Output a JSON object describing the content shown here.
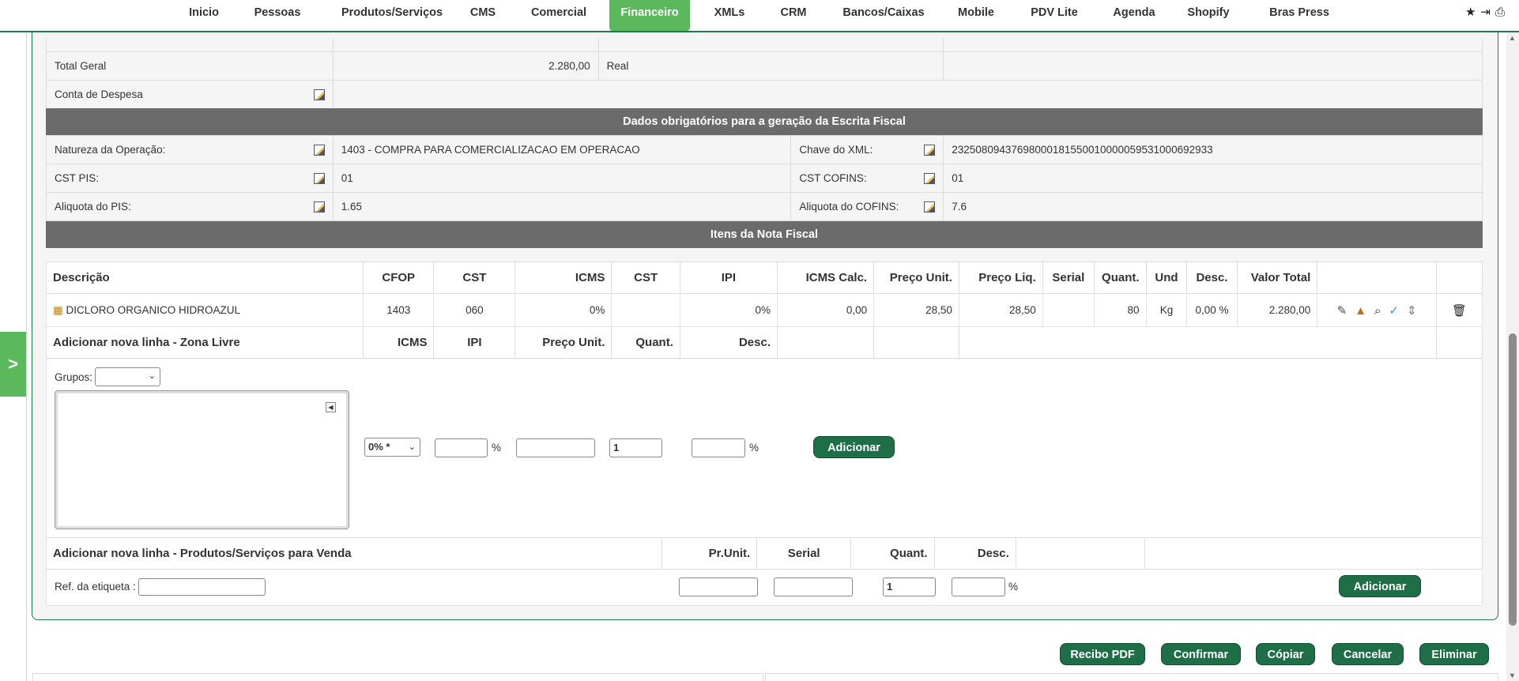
{
  "nav": {
    "items": [
      "Inicio",
      "Pessoas",
      "Produtos/Serviços",
      "CMS",
      "Comercial",
      "Financeiro",
      "XMLs",
      "CRM",
      "Bancos/Caixas",
      "Mobile",
      "PDV Lite",
      "Agenda",
      "Shopify",
      "Bras Press"
    ],
    "active": "Financeiro",
    "icons": [
      "star-icon",
      "logout-icon",
      "print-icon"
    ]
  },
  "summary": {
    "total_label": "Total Geral",
    "total_value": "2.280,00",
    "currency": "Real",
    "expense_label": "Conta de Despesa"
  },
  "fiscal": {
    "section_title": "Dados obrigatórios para a geração da Escrita Fiscal",
    "natureza_label": "Natureza da Operação:",
    "natureza_value": "1403 - COMPRA PARA COMERCIALIZACAO EM OPERACAO",
    "chave_label": "Chave do XML:",
    "chave_value": "23250809437698000181550010000059531000692933",
    "cst_pis_label": "CST PIS:",
    "cst_pis_value": "01",
    "cst_cofins_label": "CST COFINS:",
    "cst_cofins_value": "01",
    "aliq_pis_label": "Aliquota do PIS:",
    "aliq_pis_value": "1.65",
    "aliq_cofins_label": "Aliquota do COFINS:",
    "aliq_cofins_value": "7.6"
  },
  "items": {
    "section_title": "Itens da Nota Fiscal",
    "headers": [
      "Descrição",
      "CFOP",
      "CST",
      "ICMS",
      "CST",
      "IPI",
      "ICMS Calc.",
      "Preço Unit.",
      "Preço Liq.",
      "Serial",
      "Quant.",
      "Und",
      "Desc.",
      "Valor Total"
    ],
    "rows": [
      {
        "descricao": "DICLORO ORGANICO HIDROAZUL",
        "cfop": "1403",
        "cst": "060",
        "icms": "0%",
        "cst2": "",
        "ipi": "0%",
        "icms_calc": "0,00",
        "preco_unit": "28,50",
        "preco_liq": "28,50",
        "serial": "",
        "quant": "80",
        "und": "Kg",
        "desc": "0,00 %",
        "valor_total": "2.280,00"
      }
    ]
  },
  "zona_livre": {
    "title": "Adicionar nova linha - Zona Livre",
    "headers": [
      "ICMS",
      "IPI",
      "Preço Unit.",
      "Quant.",
      "Desc."
    ],
    "grupos_label": "Grupos:",
    "grupos_value": "",
    "icms_select": "0% *",
    "quant_value": "1",
    "pct_symbol": "%",
    "add_label": "Adicionar"
  },
  "produtos": {
    "title": "Adicionar nova linha - Produtos/Serviços para Venda",
    "headers": [
      "Pr.Unit.",
      "Serial",
      "Quant.",
      "Desc."
    ],
    "ref_label": "Ref. da etiqueta :",
    "quant_value": "1",
    "pct_symbol": "%",
    "add_label": "Adicionar"
  },
  "actions": [
    "Recibo PDF",
    "Confirmar",
    "Cópiar",
    "Cancelar",
    "Eliminar"
  ],
  "side_tab": ">"
}
